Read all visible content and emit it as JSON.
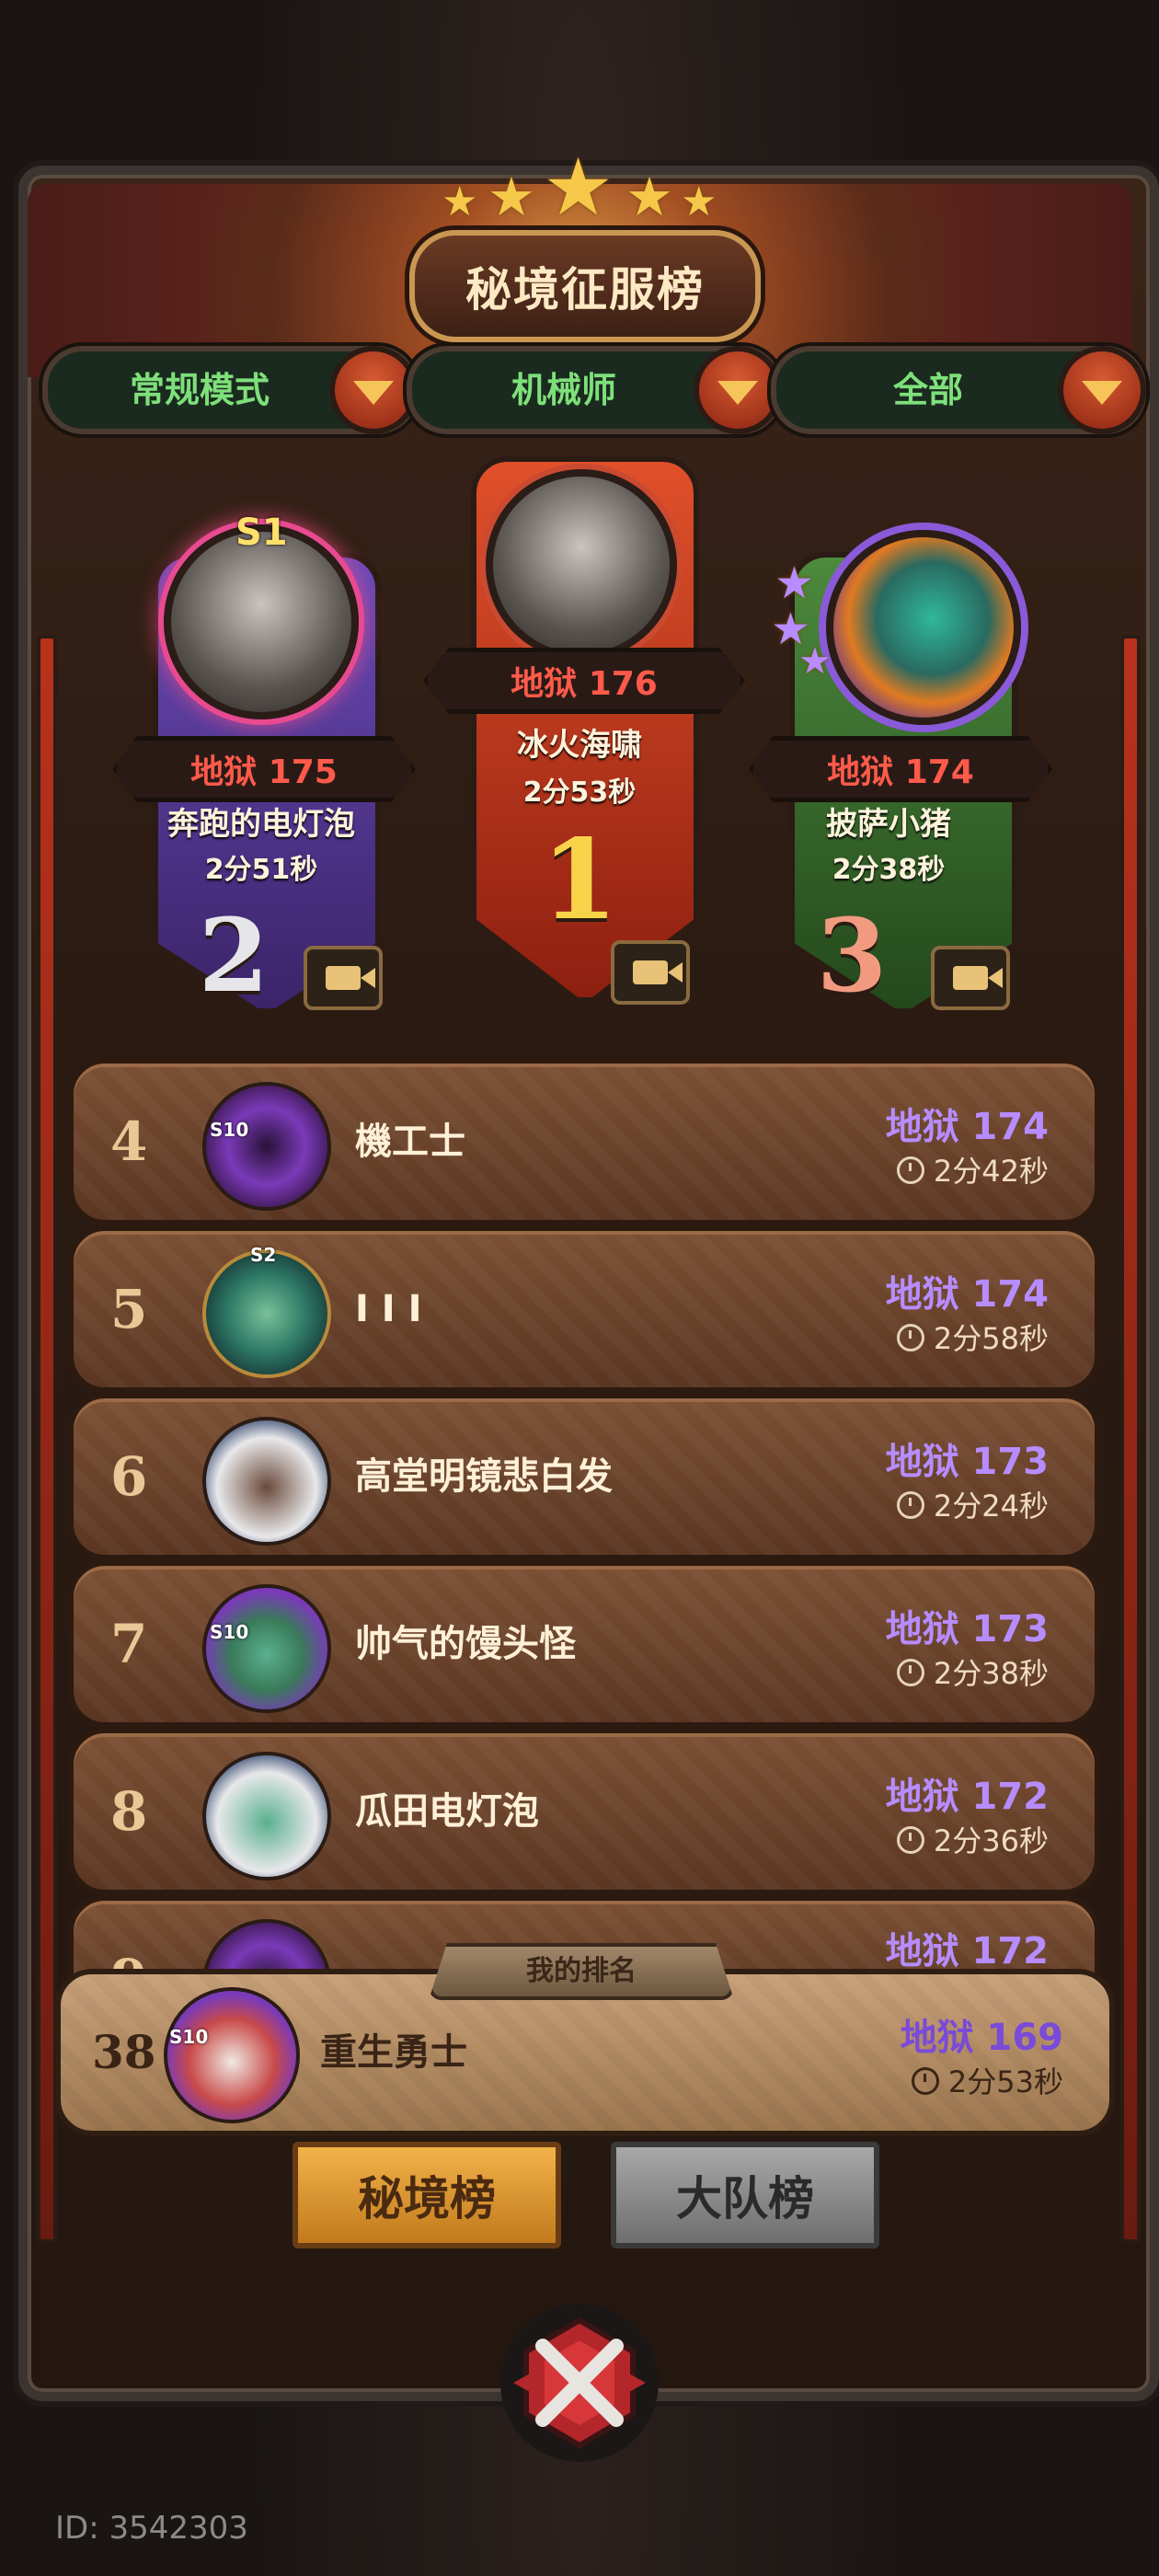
{
  "header": {
    "title": "秘境征服榜"
  },
  "filters": [
    {
      "label": "常规模式"
    },
    {
      "label": "机械师"
    },
    {
      "label": "全部"
    }
  ],
  "podium": {
    "first": {
      "rank": "1",
      "level": "地狱 176",
      "name": "冰火海啸",
      "time": "2分53秒"
    },
    "second": {
      "rank": "2",
      "level": "地狱 175",
      "name": "奔跑的电灯泡",
      "time": "2分51秒",
      "season_badge": "S1"
    },
    "third": {
      "rank": "3",
      "level": "地狱 174",
      "name": "披萨小猪",
      "time": "2分38秒"
    }
  },
  "rows": [
    {
      "rank": "4",
      "name": "機工士",
      "level": "地狱 174",
      "time": "2分42秒",
      "badge": "S10"
    },
    {
      "rank": "5",
      "name": "I I I",
      "level": "地狱 174",
      "time": "2分58秒",
      "badge": "S2"
    },
    {
      "rank": "6",
      "name": "高堂明镜悲白发",
      "level": "地狱 173",
      "time": "2分24秒"
    },
    {
      "rank": "7",
      "name": "帅气的馒头怪",
      "level": "地狱 173",
      "time": "2分38秒",
      "badge": "S10"
    },
    {
      "rank": "8",
      "name": "瓜田电灯泡",
      "level": "地狱 172",
      "time": "2分36秒"
    },
    {
      "rank": "9",
      "level": "地狱 172"
    }
  ],
  "my_rank": {
    "label": "我的排名",
    "rank": "38",
    "name": "重生勇士",
    "level": "地狱 169",
    "time": "2分53秒",
    "badge": "S10"
  },
  "tabs": [
    {
      "label": "秘境榜",
      "active": true
    },
    {
      "label": "大队榜",
      "active": false
    }
  ],
  "footer": {
    "id_text": "ID: 3542303"
  },
  "colors": {
    "level_red": "#ff5a4a",
    "level_purple": "#b78cff",
    "filter_green": "#7ee07a"
  }
}
